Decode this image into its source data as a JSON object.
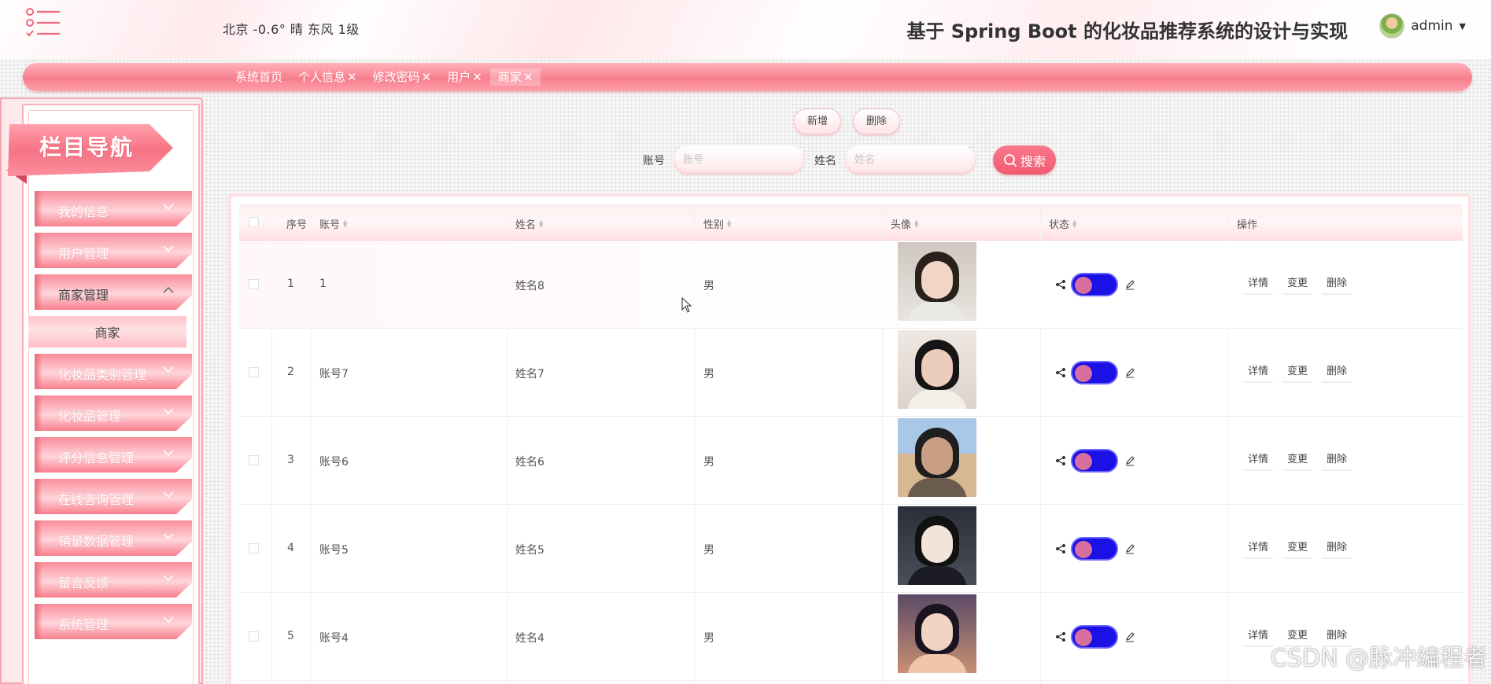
{
  "header": {
    "weather": "北京  -0.6°  晴  东风  1级",
    "title": "基于 Spring Boot 的化妆品推荐系统的设计与实现",
    "user_name": "admin"
  },
  "tabs": [
    {
      "label": "系统首页",
      "closable": false
    },
    {
      "label": "个人信息",
      "closable": true
    },
    {
      "label": "修改密码",
      "closable": true
    },
    {
      "label": "用户",
      "closable": true
    },
    {
      "label": "商家",
      "closable": true,
      "active": true
    }
  ],
  "sidebar": {
    "banner": "栏目导航",
    "items": [
      {
        "label": "我的信息",
        "open": false
      },
      {
        "label": "用户管理",
        "open": false
      },
      {
        "label": "商家管理",
        "open": true,
        "children": [
          "商家"
        ]
      },
      {
        "label": "化妆品类别管理",
        "open": false
      },
      {
        "label": "化妆品管理",
        "open": false
      },
      {
        "label": "评分信息管理",
        "open": false
      },
      {
        "label": "在线咨询管理",
        "open": false
      },
      {
        "label": "销量数据管理",
        "open": false
      },
      {
        "label": "留言反馈",
        "open": false
      },
      {
        "label": "系统管理",
        "open": false
      }
    ]
  },
  "toolbar": {
    "add": "新增",
    "delete": "删除"
  },
  "search": {
    "account_label": "账号",
    "account_placeholder": "账号",
    "name_label": "姓名",
    "name_placeholder": "姓名",
    "button": "搜索"
  },
  "table": {
    "headers": {
      "index": "序号",
      "account": "账号",
      "name": "姓名",
      "gender": "性别",
      "avatar": "头像",
      "status": "状态",
      "actions": "操作"
    },
    "actions": {
      "detail": "详情",
      "change": "变更",
      "delete": "删除"
    },
    "rows": [
      {
        "index": "1",
        "account": "1",
        "name": "姓名8",
        "gender": "男",
        "status_on": true
      },
      {
        "index": "2",
        "account": "账号7",
        "name": "姓名7",
        "gender": "男",
        "status_on": true
      },
      {
        "index": "3",
        "account": "账号6",
        "name": "姓名6",
        "gender": "男",
        "status_on": true
      },
      {
        "index": "4",
        "account": "账号5",
        "name": "姓名5",
        "gender": "男",
        "status_on": true
      },
      {
        "index": "5",
        "account": "账号4",
        "name": "姓名4",
        "gender": "男",
        "status_on": true
      }
    ]
  },
  "colors": {
    "accent": "#f25a70",
    "toggle": "#1a11e4",
    "knob": "#d66f9d"
  },
  "watermark": "CSDN @脉冲编程者"
}
